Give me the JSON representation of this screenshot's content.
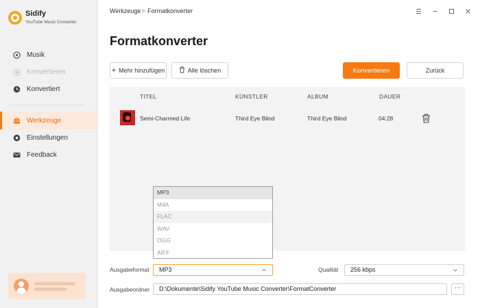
{
  "app": {
    "name": "Sidify",
    "subtitle": "YouTube Music Converter",
    "accent": "#f57a12"
  },
  "sidebar": {
    "items": [
      {
        "label": "Musik",
        "icon": "music-icon"
      },
      {
        "label": "Konvertieren",
        "icon": "convert-icon",
        "state": "disabled"
      },
      {
        "label": "Konvertiert",
        "icon": "clock-icon"
      },
      {
        "label": "Werkzeuge",
        "icon": "toolbox-icon",
        "state": "active"
      },
      {
        "label": "Einstellungen",
        "icon": "gear-icon"
      },
      {
        "label": "Feedback",
        "icon": "mail-icon"
      }
    ]
  },
  "breadcrumb": {
    "parent": "Werkzeuge",
    "separator": ">",
    "current": "Formatkonverter"
  },
  "window": {
    "controls": [
      "menu-icon",
      "minimize-icon",
      "maximize-icon",
      "close-icon"
    ]
  },
  "page": {
    "title": "Formatkonverter"
  },
  "toolbar": {
    "add_label": "Mehr hinzufügen",
    "clear_label": "Alle löschen",
    "convert_label": "Konvertieren",
    "back_label": "Zurück"
  },
  "table": {
    "headers": {
      "title": "TITEL",
      "artist": "KÜNSTLER",
      "album": "ALBUM",
      "duration": "DAUER"
    },
    "rows": [
      {
        "title": "Semi-Charmed Life",
        "artist": "Third Eye Blind",
        "album": "Third Eye Blind",
        "duration": "04:28"
      }
    ]
  },
  "format_dropdown": {
    "options": [
      "MP3",
      "M4A",
      "FLAC",
      "WAV",
      "OGG",
      "AIFF"
    ],
    "selected": "MP3",
    "hovered": "FLAC"
  },
  "output": {
    "format_label": "Ausgabeformat",
    "format_value": "MP3",
    "quality_label": "Qualität",
    "quality_value": "256 kbps",
    "folder_label": "Ausgabeordner",
    "folder_value": "D:\\Dokumente\\Sidify YouTube Music Converter\\FormatConverter",
    "browse_label": "···"
  }
}
